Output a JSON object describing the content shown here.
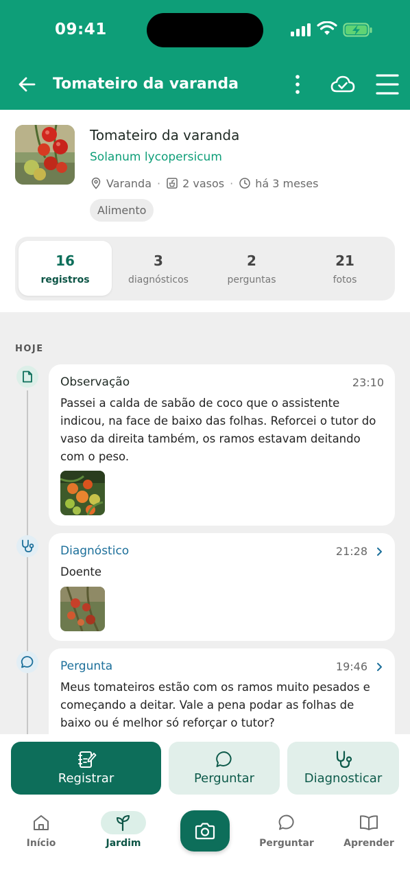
{
  "status_bar": {
    "time": "09:41"
  },
  "appbar": {
    "title": "Tomateiro da varanda"
  },
  "plant": {
    "name": "Tomateiro da varanda",
    "scientific_name": "Solanum lycopersicum",
    "location": "Varanda",
    "pots": "2 vasos",
    "age": "há 3 meses",
    "tag": "Alimento"
  },
  "stats": [
    {
      "value": "16",
      "label": "registros",
      "active": true
    },
    {
      "value": "3",
      "label": "diagnósticos",
      "active": false
    },
    {
      "value": "2",
      "label": "perguntas",
      "active": false
    },
    {
      "value": "21",
      "label": "fotos",
      "active": false
    }
  ],
  "timeline": {
    "day_label": "HOJE",
    "entries": [
      {
        "type": "Observação",
        "time": "23:10",
        "text": "Passei a calda de sabão de coco que o assistente indicou, na face de baixo das folhas. Reforcei o tutor do vaso da direita também, os ramos estavam deitando com o peso.",
        "icon": "note-icon",
        "has_photo": true
      },
      {
        "type": "Diagnóstico",
        "time": "21:28",
        "text": "Doente",
        "icon": "stethoscope-icon",
        "has_photo": true
      },
      {
        "type": "Pergunta",
        "time": "19:46",
        "text": "Meus tomateiros estão com os ramos muito pesados e começando a deitar. Vale a pena podar as folhas de baixo ou é melhor só reforçar o tutor?",
        "icon": "chat-bubble-icon",
        "has_photo": false
      }
    ]
  },
  "actions": {
    "register": "Registrar",
    "ask": "Perguntar",
    "diagnose": "Diagnosticar"
  },
  "nav": {
    "home": "Início",
    "garden": "Jardim",
    "ask": "Perguntar",
    "learn": "Aprender",
    "active": "garden"
  },
  "colors": {
    "brand": "#0e9e78",
    "brand_dark": "#0d6e5a",
    "question_blue": "#1c6f9a"
  }
}
